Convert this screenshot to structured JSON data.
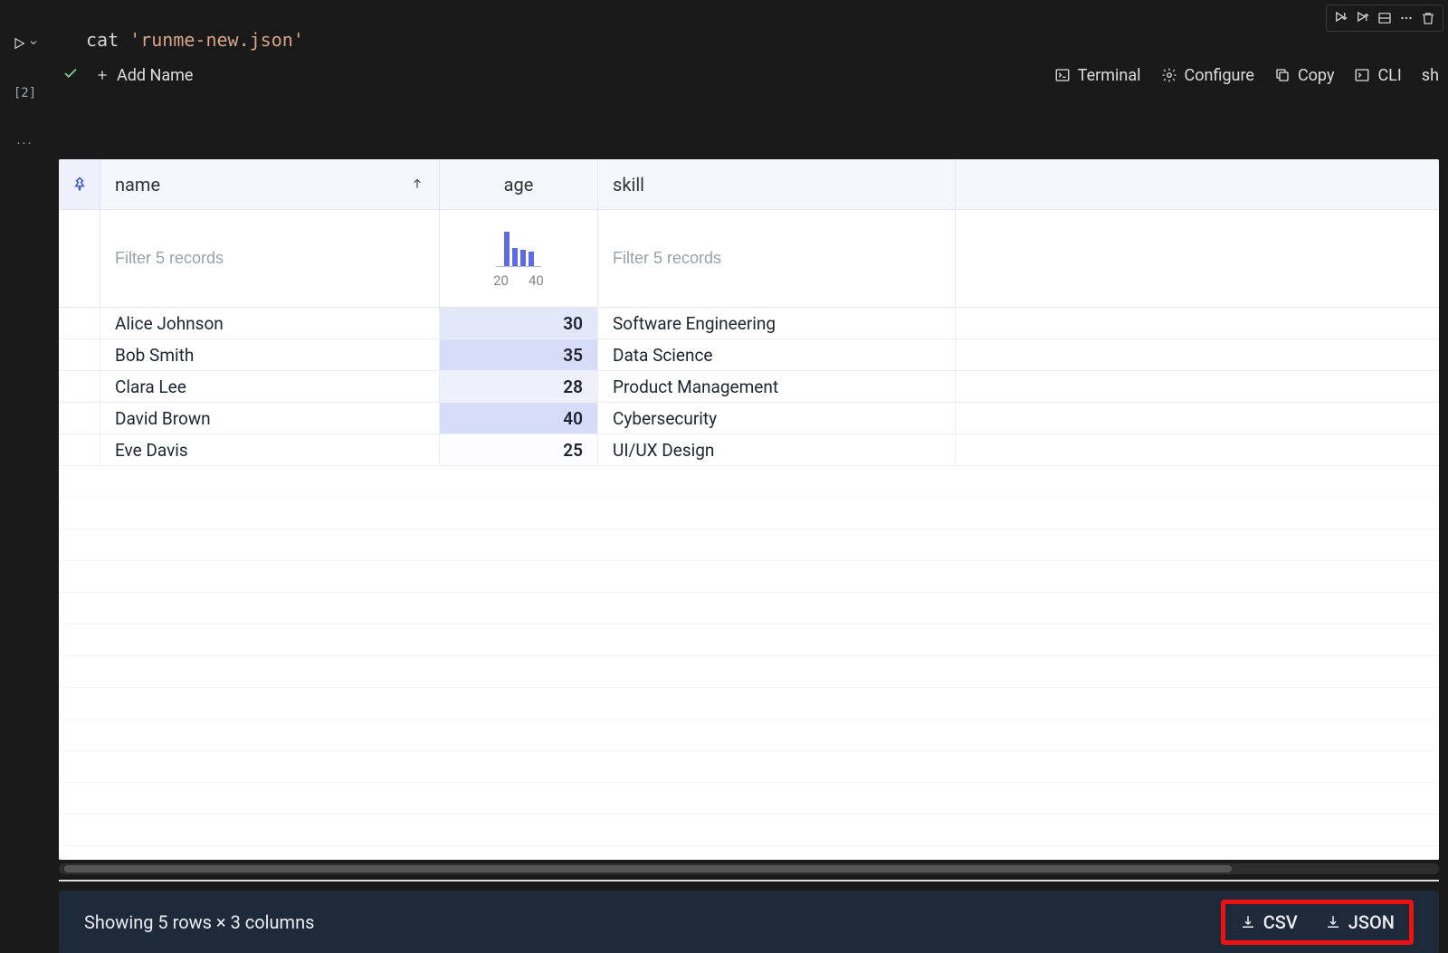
{
  "cell": {
    "index_label": "[2]",
    "code_prefix": "cat ",
    "code_string": "'runme-new.json'",
    "add_name_label": "Add Name"
  },
  "actions": {
    "terminal": "Terminal",
    "configure": "Configure",
    "copy": "Copy",
    "cli": "CLI",
    "sh": "sh"
  },
  "table": {
    "columns": {
      "name": "name",
      "age": "age",
      "skill": "skill"
    },
    "filter_placeholder": "Filter 5 records",
    "age_hist": {
      "labels": [
        "20",
        "40"
      ],
      "bars": [
        38,
        20,
        18,
        16
      ],
      "max": 40
    },
    "rows": [
      {
        "name": "Alice Johnson",
        "age": "30",
        "skill": "Software Engineering",
        "shade": 2
      },
      {
        "name": "Bob Smith",
        "age": "35",
        "skill": "Data Science",
        "shade": 3
      },
      {
        "name": "Clara Lee",
        "age": "28",
        "skill": "Product Management",
        "shade": 1
      },
      {
        "name": "David Brown",
        "age": "40",
        "skill": "Cybersecurity",
        "shade": 3
      },
      {
        "name": "Eve Davis",
        "age": "25",
        "skill": "UI/UX Design",
        "shade": 0
      }
    ]
  },
  "status": {
    "text": "Showing 5 rows × 3 columns",
    "csv": "CSV",
    "json": "JSON"
  },
  "chart_data": {
    "type": "table",
    "columns": [
      "name",
      "age",
      "skill"
    ],
    "rows": [
      [
        "Alice Johnson",
        30,
        "Software Engineering"
      ],
      [
        "Bob Smith",
        35,
        "Data Science"
      ],
      [
        "Clara Lee",
        28,
        "Product Management"
      ],
      [
        "David Brown",
        40,
        "Cybersecurity"
      ],
      [
        "Eve Davis",
        25,
        "UI/UX Design"
      ]
    ],
    "age_histogram": {
      "x_range": [
        20,
        40
      ]
    }
  }
}
